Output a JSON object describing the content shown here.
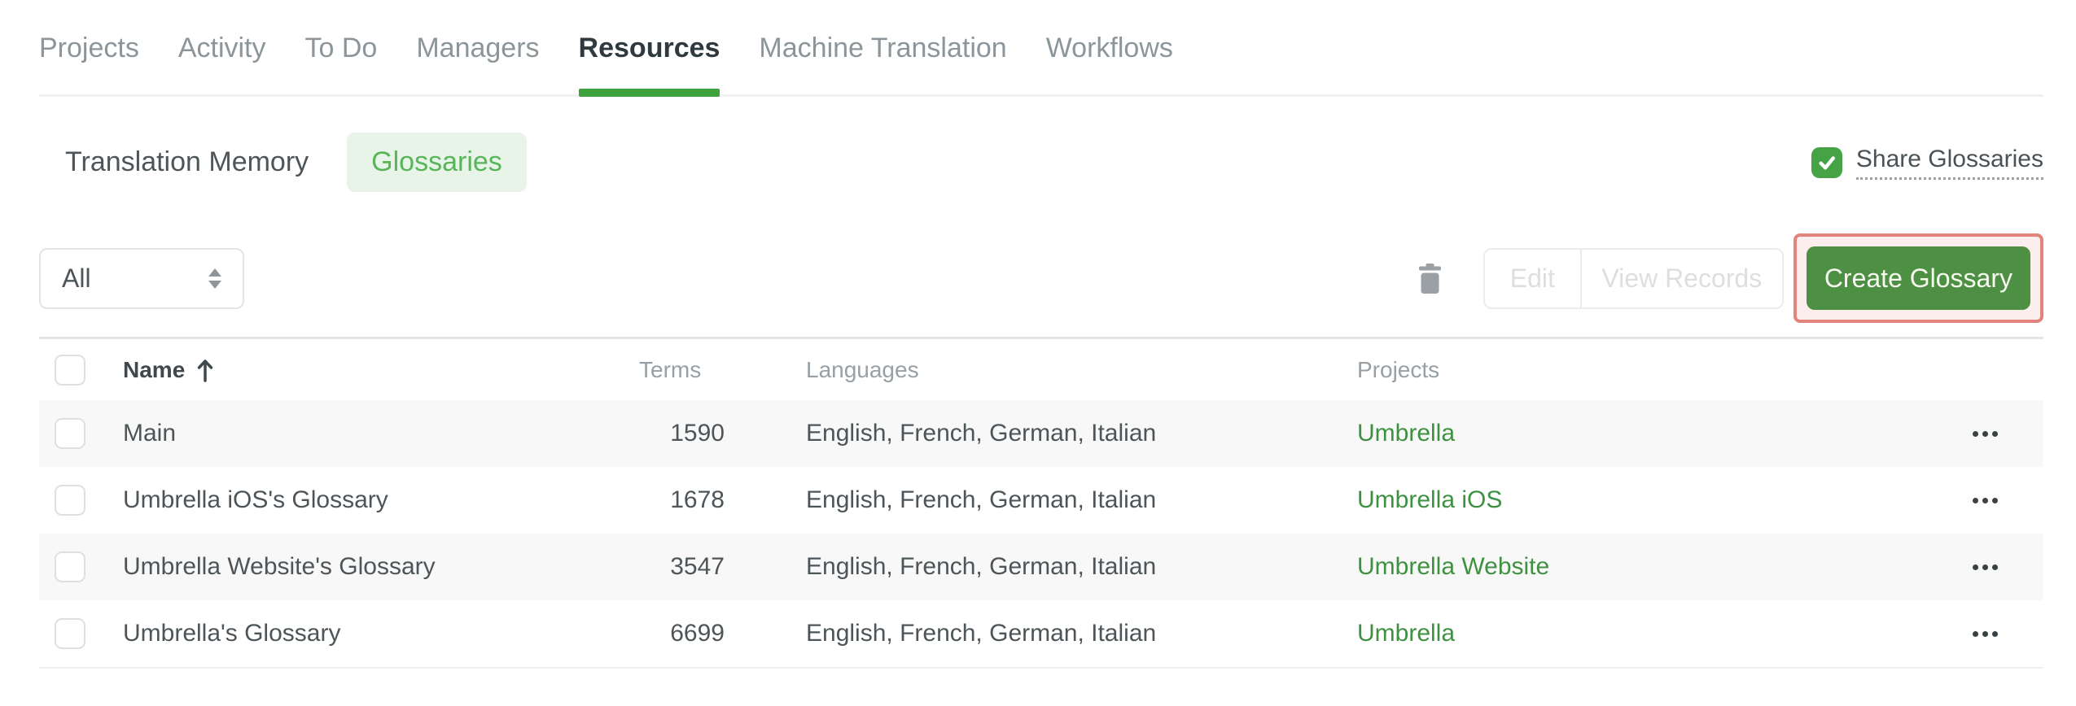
{
  "nav": {
    "tabs": [
      {
        "label": "Projects",
        "active": false
      },
      {
        "label": "Activity",
        "active": false
      },
      {
        "label": "To Do",
        "active": false
      },
      {
        "label": "Managers",
        "active": false
      },
      {
        "label": "Resources",
        "active": true
      },
      {
        "label": "Machine Translation",
        "active": false
      },
      {
        "label": "Workflows",
        "active": false
      }
    ]
  },
  "subnav": {
    "tabs": [
      {
        "label": "Translation Memory",
        "active": false
      },
      {
        "label": "Glossaries",
        "active": true
      }
    ],
    "share": {
      "label": "Share Glossaries",
      "checked": true
    }
  },
  "toolbar": {
    "filter_value": "All",
    "edit_label": "Edit",
    "view_records_label": "View Records",
    "create_label": "Create Glossary",
    "edit_disabled": true,
    "view_records_disabled": true,
    "create_highlighted": true
  },
  "table": {
    "headers": {
      "name": "Name",
      "terms": "Terms",
      "languages": "Languages",
      "projects": "Projects"
    },
    "sort": {
      "column": "Name",
      "direction": "ascending"
    },
    "rows": [
      {
        "name": "Main",
        "terms": "1590",
        "languages": "English, French, German, Italian",
        "project": "Umbrella",
        "checked": false
      },
      {
        "name": "Umbrella iOS's Glossary",
        "terms": "1678",
        "languages": "English, French, German, Italian",
        "project": "Umbrella iOS",
        "checked": false
      },
      {
        "name": "Umbrella Website's Glossary",
        "terms": "3547",
        "languages": "English, French, German, Italian",
        "project": "Umbrella Website",
        "checked": false
      },
      {
        "name": "Umbrella's Glossary",
        "terms": "6699",
        "languages": "English, French, German, Italian",
        "project": "Umbrella",
        "checked": false
      }
    ]
  },
  "icons": {
    "delete": "trash-icon",
    "filter_caret": "up-down-caret-icon",
    "name_sort": "arrow-up-icon",
    "share_check": "checkmark-icon",
    "row_menu": "horizontal-ellipsis-icon"
  },
  "colors": {
    "accent_green": "#3fa23d",
    "pill_bg": "#e8f4e8",
    "pill_text": "#58b55a",
    "button_green": "#4d9044",
    "link_green": "#3f9142",
    "highlight_border": "#e3837e",
    "highlight_bg": "#fceeed",
    "row_alt_bg": "#f8f8f8",
    "disabled_text": "#dcdee0"
  }
}
